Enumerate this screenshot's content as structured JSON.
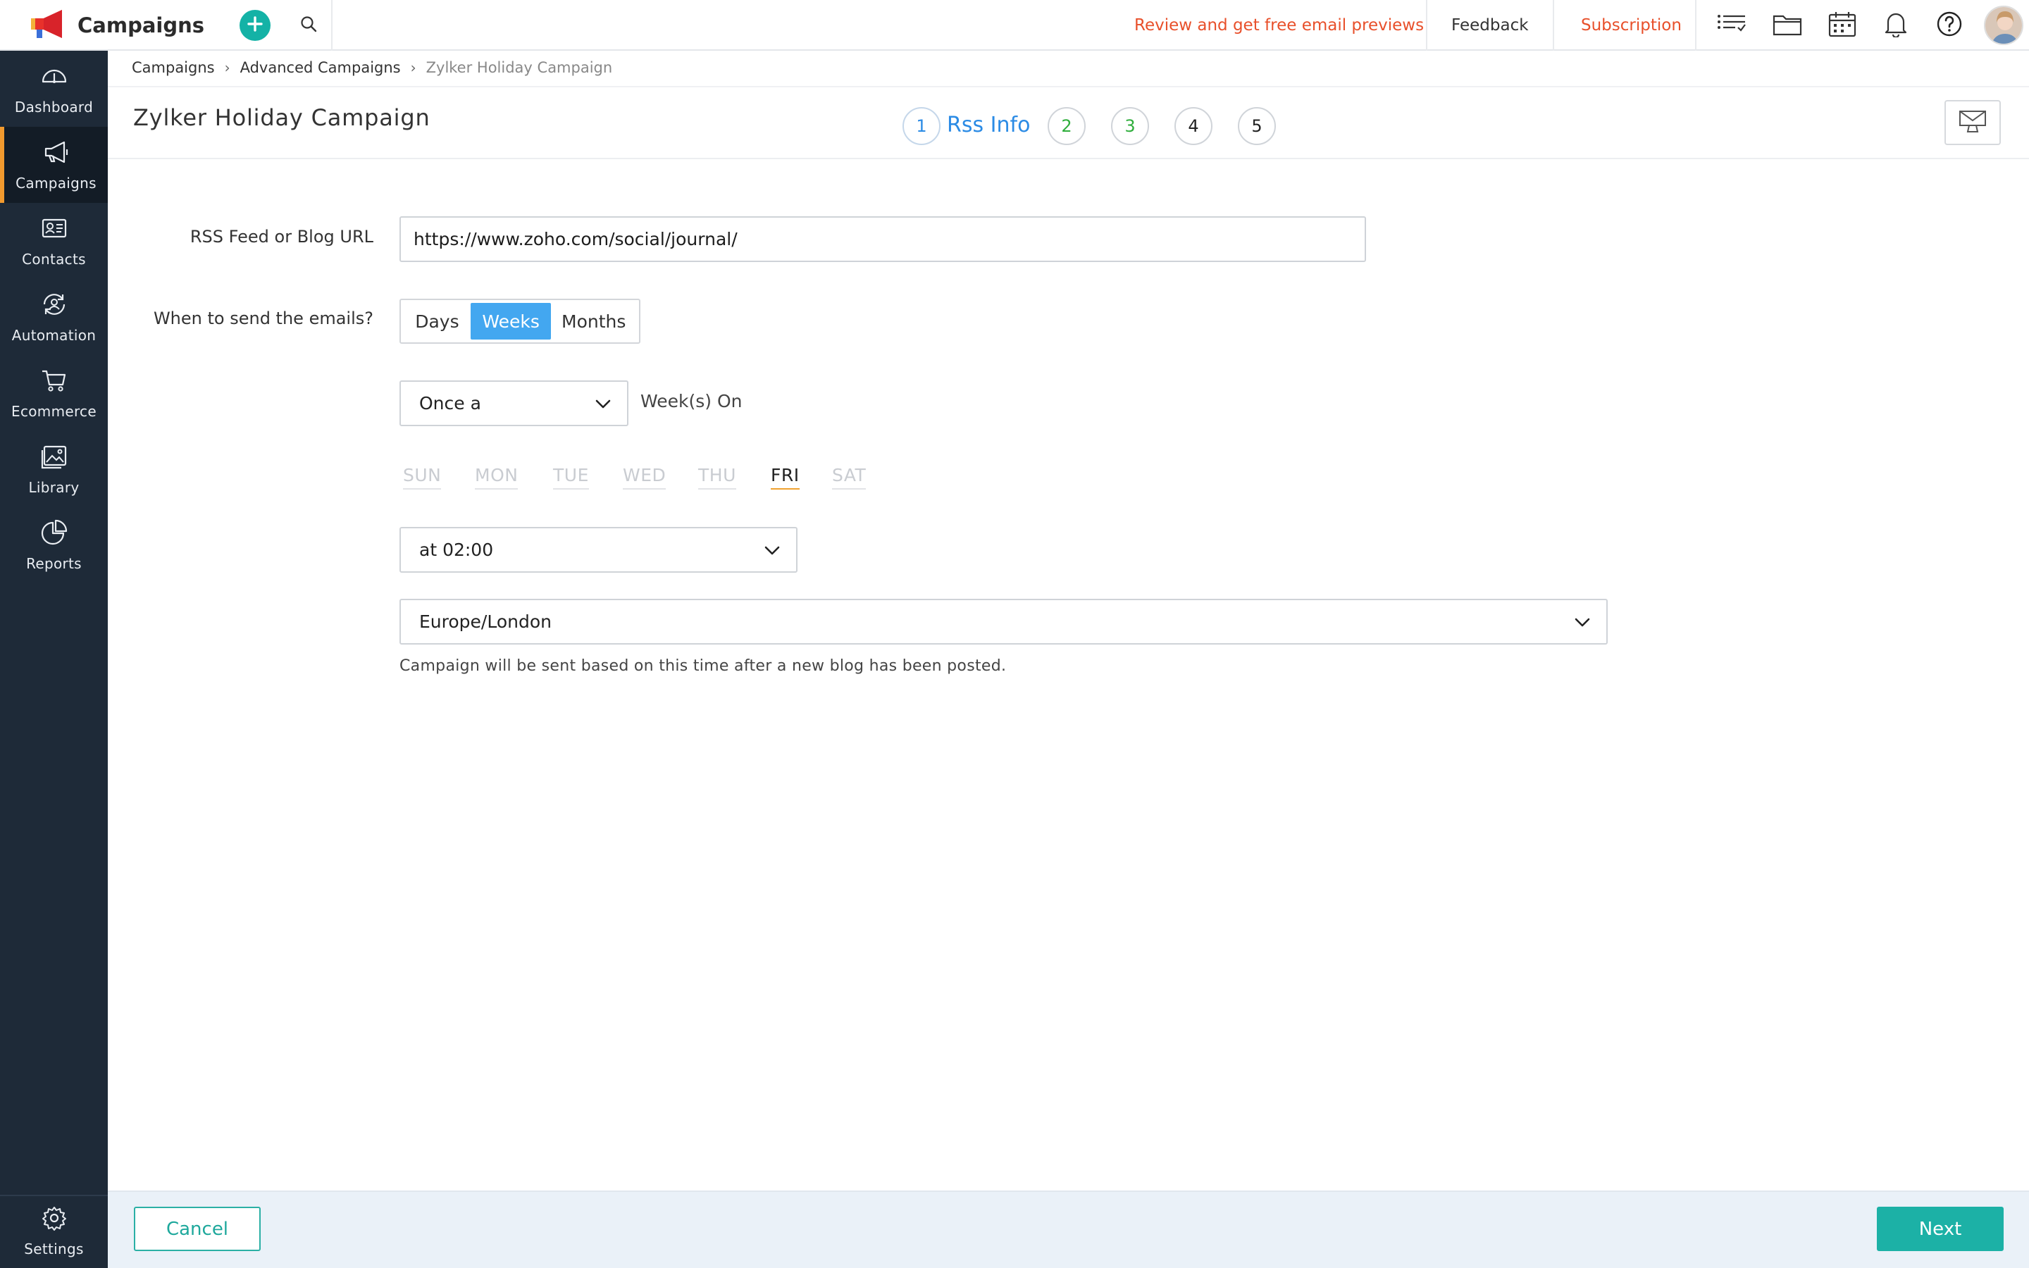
{
  "app": {
    "name": "Campaigns",
    "accent": "#14b2a6",
    "brand_orange": "#e8502b"
  },
  "topbar": {
    "review_link": "Review and get free email previews",
    "feedback": "Feedback",
    "subscription": "Subscription",
    "icons": [
      "add-icon",
      "search-icon",
      "list-icon",
      "folder-icon",
      "calendar-icon",
      "bell-icon",
      "help-icon"
    ]
  },
  "sidebar": {
    "items": [
      {
        "label": "Dashboard",
        "icon": "gauge-icon"
      },
      {
        "label": "Campaigns",
        "icon": "megaphone-icon",
        "active": true
      },
      {
        "label": "Contacts",
        "icon": "contact-card-icon"
      },
      {
        "label": "Automation",
        "icon": "automation-icon"
      },
      {
        "label": "Ecommerce",
        "icon": "cart-icon"
      },
      {
        "label": "Library",
        "icon": "image-icon"
      },
      {
        "label": "Reports",
        "icon": "pie-chart-icon"
      }
    ],
    "settings": "Settings"
  },
  "breadcrumb": {
    "items": [
      "Campaigns",
      "Advanced Campaigns"
    ],
    "current": "Zylker Holiday Campaign"
  },
  "page": {
    "title": "Zylker Holiday Campaign"
  },
  "steps": {
    "items": [
      "1",
      "2",
      "3",
      "4",
      "5"
    ],
    "active_label": "Rss Info"
  },
  "form": {
    "url_label": "RSS Feed or Blog URL",
    "url_value": "https://www.zoho.com/social/journal/",
    "when_label": "When to send the emails?",
    "frequency_options": [
      "Days",
      "Weeks",
      "Months"
    ],
    "frequency_selected": "Weeks",
    "interval_value": "Once a",
    "interval_suffix": "Week(s) On",
    "days": [
      "SUN",
      "MON",
      "TUE",
      "WED",
      "THU",
      "FRI",
      "SAT"
    ],
    "day_selected": "FRI",
    "time_value": "at 02:00",
    "timezone_value": "Europe/London",
    "hint": "Campaign will be sent based on this time after a new blog has been posted."
  },
  "footer": {
    "cancel": "Cancel",
    "next": "Next"
  }
}
